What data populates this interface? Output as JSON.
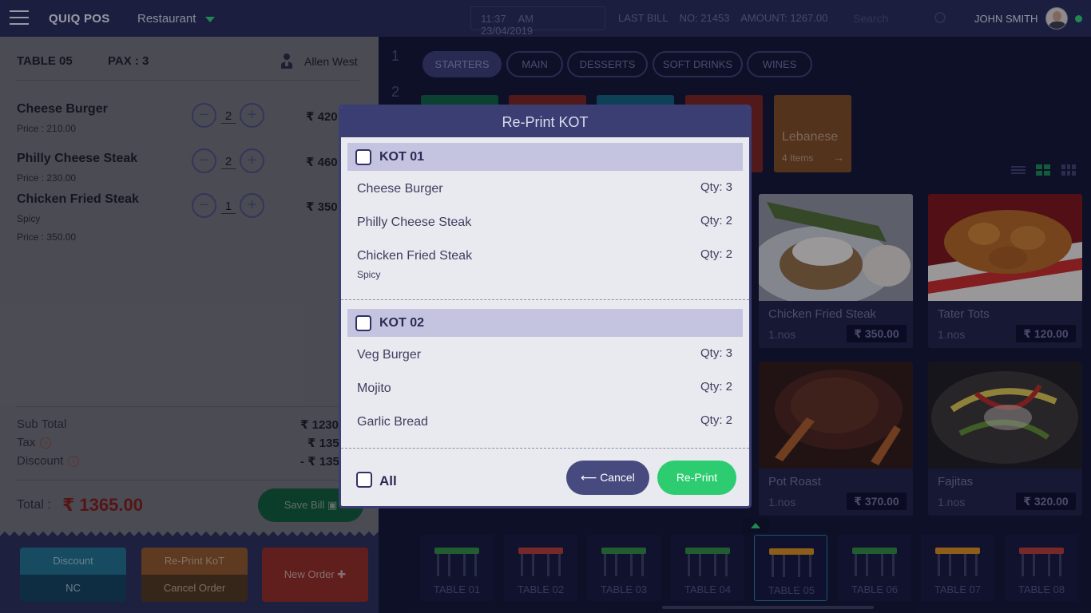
{
  "topbar": {
    "brand": "QUIQ POS",
    "venue": "Restaurant",
    "time": "11:37 AM",
    "date": "23/04/2019",
    "last_bill": "LAST BILL    NO: 21453    AMOUNT: 1267.00",
    "search_placeholder": "Search",
    "user": "JOHN SMITH"
  },
  "order": {
    "table": "TABLE 05",
    "pax": "PAX : 3",
    "waiter": "Allen West",
    "items": [
      {
        "name": "Cheese Burger",
        "sub": "Price  : 210.00",
        "qty": "2",
        "price": "₹ 420"
      },
      {
        "name": "Philly Cheese Steak",
        "sub": "Price  : 230.00",
        "qty": "2",
        "price": "₹ 460"
      },
      {
        "name": "Chicken Fried Steak",
        "note": "Spicy",
        "sub": "Price  : 350.00",
        "qty": "1",
        "price": "₹ 350"
      }
    ],
    "subtotal_label": "Sub Total",
    "subtotal": "₹ 1230",
    "tax_label": "Tax",
    "tax": "₹ 135",
    "discount_label": "Discount",
    "discount": "- ₹ 135",
    "total_label": "Total  :",
    "total": "₹ 1365.00",
    "save_bill": "Save Bill"
  },
  "actions": {
    "discount": "Discount",
    "nc": "NC",
    "reprint_kot": "Re-Print KoT",
    "cancel_order": "Cancel Order",
    "new_order": "New Order"
  },
  "menu": {
    "numbers": [
      "1",
      "2"
    ],
    "categories": [
      "STARTERS",
      "MAIN",
      "DESSERTS",
      "SOFT DRINKS",
      "WINES"
    ],
    "lebanese": {
      "name": "Lebanese",
      "count": "4 Items"
    },
    "products": [
      {
        "name": "Chicken Fried Steak",
        "unit": "1.nos",
        "price": "₹ 350.00"
      },
      {
        "name": "Tater Tots",
        "unit": "1.nos",
        "price": "₹ 120.00"
      },
      {
        "name": "Pot Roast",
        "unit": "1.nos",
        "price": "₹ 370.00"
      },
      {
        "name": "Fajitas",
        "unit": "1.nos",
        "price": "₹ 320.00"
      }
    ],
    "tables": [
      {
        "label": "TABLE 01",
        "color": "#2e8a3e"
      },
      {
        "label": "TABLE 02",
        "color": "#b23b32"
      },
      {
        "label": "TABLE 03",
        "color": "#2e8a3e"
      },
      {
        "label": "TABLE 04",
        "color": "#2e8a3e"
      },
      {
        "label": "TABLE 05",
        "color": "#d68a1b"
      },
      {
        "label": "TABLE 06",
        "color": "#2e8a3e"
      },
      {
        "label": "TABLE 07",
        "color": "#d68a1b"
      },
      {
        "label": "TABLE 08",
        "color": "#b23b32"
      }
    ]
  },
  "modal": {
    "title": "Re-Print KOT",
    "kots": [
      {
        "label": "KOT 01",
        "items": [
          {
            "name": "Cheese Burger",
            "qty": "Qty: 3"
          },
          {
            "name": "Philly Cheese Steak",
            "qty": "Qty: 2"
          },
          {
            "name": "Chicken Fried Steak",
            "qty": "Qty: 2",
            "note": "Spicy"
          }
        ]
      },
      {
        "label": "KOT 02",
        "items": [
          {
            "name": "Veg Burger",
            "qty": "Qty: 3"
          },
          {
            "name": "Mojito",
            "qty": "Qty: 2"
          },
          {
            "name": "Garlic Bread",
            "qty": "Qty: 2"
          }
        ]
      }
    ],
    "all_label": "All",
    "cancel": "Cancel",
    "reprint": "Re-Print"
  }
}
